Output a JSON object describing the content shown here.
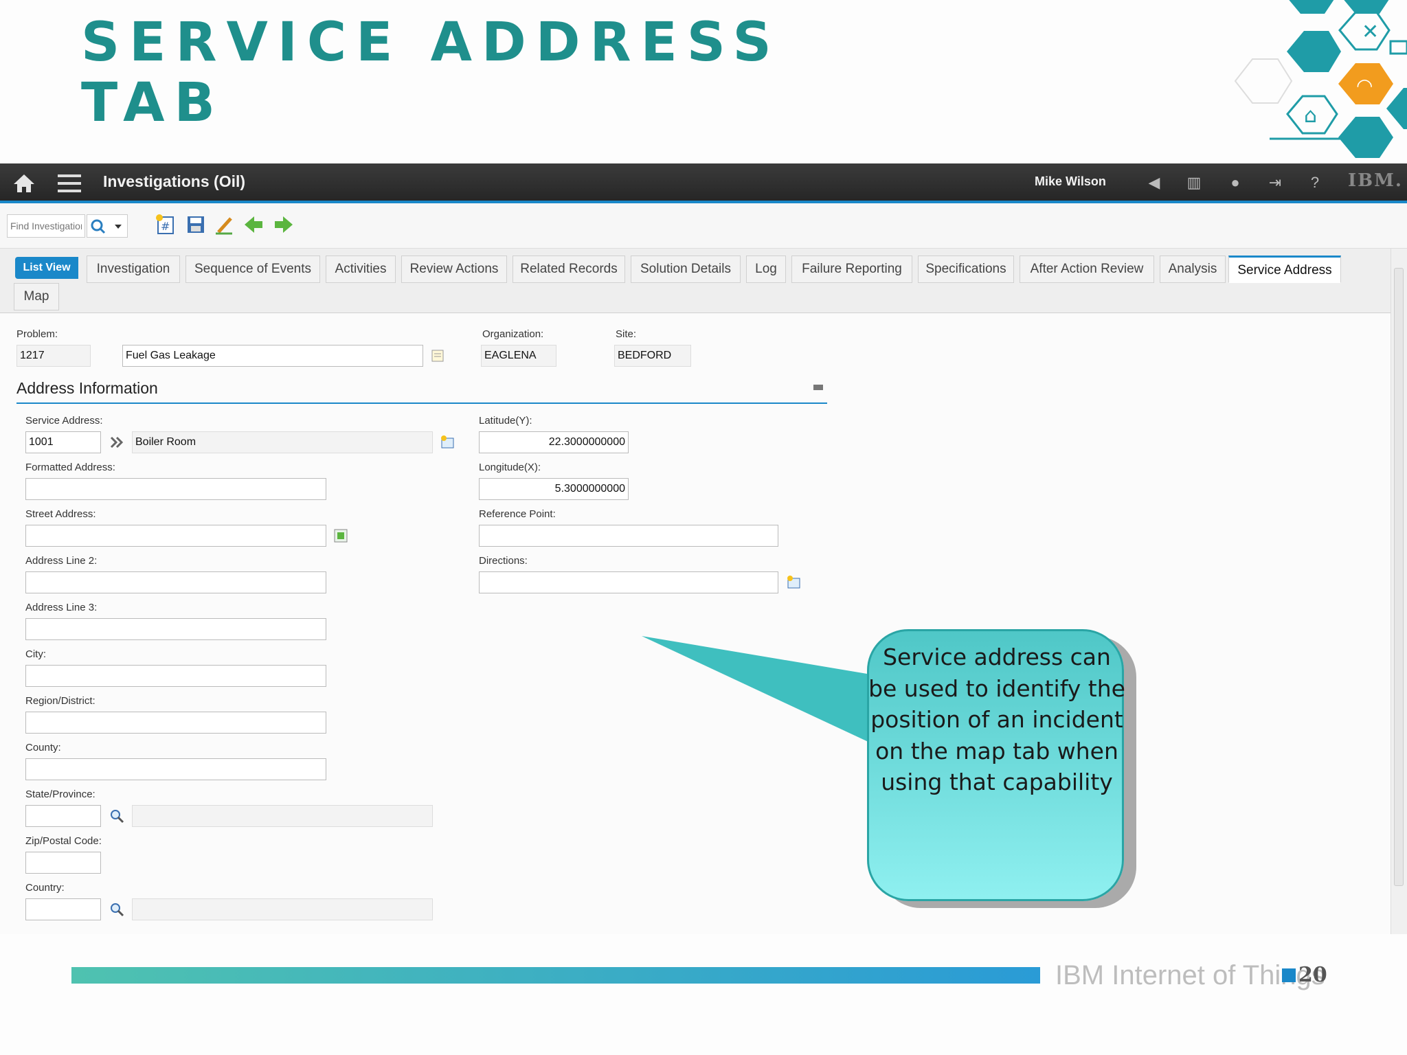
{
  "slide": {
    "title": "Service Address Tab",
    "footer": "IBM Internet of Things",
    "page_number": "20"
  },
  "header": {
    "app_title": "Investigations (Oil)",
    "user_name": "Mike Wilson",
    "logo": "IBM."
  },
  "toolbar": {
    "find_placeholder": "Find Investigation"
  },
  "tabs": {
    "list_view": "List View",
    "items": [
      {
        "label": "Investigation"
      },
      {
        "label": "Sequence of Events"
      },
      {
        "label": "Activities"
      },
      {
        "label": "Review Actions"
      },
      {
        "label": "Related Records"
      },
      {
        "label": "Solution Details"
      },
      {
        "label": "Log"
      },
      {
        "label": "Failure Reporting"
      },
      {
        "label": "Specifications"
      },
      {
        "label": "After Action Review"
      },
      {
        "label": "Analysis"
      },
      {
        "label": "Service Address"
      },
      {
        "label": "Map"
      }
    ]
  },
  "record": {
    "problem_label": "Problem:",
    "problem_value": "1217",
    "problem_desc": "Fuel Gas Leakage",
    "org_label": "Organization:",
    "org_value": "EAGLENA",
    "site_label": "Site:",
    "site_value": "BEDFORD"
  },
  "address": {
    "section_title": "Address Information",
    "service_address_label": "Service Address:",
    "service_address_value": "1001",
    "service_address_desc": "Boiler Room",
    "formatted_address_label": "Formatted Address:",
    "street_address_label": "Street Address:",
    "address_line2_label": "Address Line 2:",
    "address_line3_label": "Address Line 3:",
    "city_label": "City:",
    "region_label": "Region/District:",
    "county_label": "County:",
    "state_label": "State/Province:",
    "zip_label": "Zip/Postal Code:",
    "country_label": "Country:",
    "latitude_label": "Latitude(Y):",
    "latitude_value": "22.3000000000",
    "longitude_label": "Longitude(X):",
    "longitude_value": "5.3000000000",
    "reference_point_label": "Reference Point:",
    "directions_label": "Directions:"
  },
  "callout": {
    "text": "Service address can be used to identify the position of an incident on the map tab when using that capability"
  },
  "colors": {
    "accent": "#1a88c9",
    "title_teal": "#1f8f8c",
    "callout_fill": "#5fd6d6"
  }
}
